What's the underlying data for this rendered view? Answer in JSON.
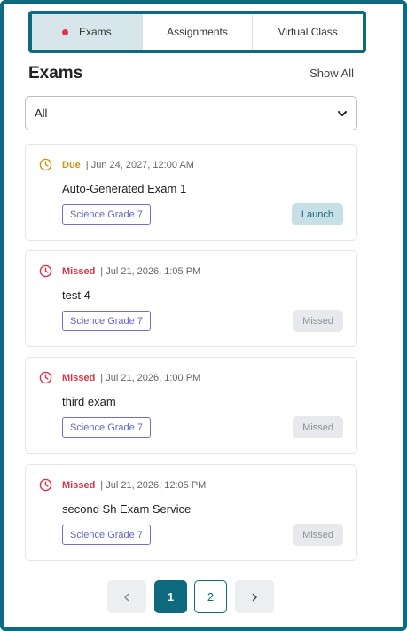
{
  "tabs": [
    {
      "label": "Exams",
      "active": true
    },
    {
      "label": "Assignments",
      "active": false
    },
    {
      "label": "Virtual Class",
      "active": false
    }
  ],
  "header": {
    "title": "Exams",
    "show_all": "Show All"
  },
  "filter": {
    "selected": "All"
  },
  "exams": [
    {
      "status": "Due",
      "date": "| Jun 24, 2027, 12:00 AM",
      "title": "Auto-Generated Exam 1",
      "tag": "Science Grade 7",
      "action": "Launch"
    },
    {
      "status": "Missed",
      "date": "| Jul 21, 2026, 1:05 PM",
      "title": "test 4",
      "tag": "Science Grade 7",
      "action": "Missed"
    },
    {
      "status": "Missed",
      "date": "| Jul 21, 2026, 1:00 PM",
      "title": "third exam",
      "tag": "Science Grade 7",
      "action": "Missed"
    },
    {
      "status": "Missed",
      "date": "| Jul 21, 2026, 12:05 PM",
      "title": "second Sh Exam Service",
      "tag": "Science Grade 7",
      "action": "Missed"
    }
  ],
  "pagination": {
    "prev": "‹",
    "pages": [
      "1",
      "2"
    ],
    "current": "1",
    "next": "›"
  },
  "colors": {
    "primary": "#0e6b7f",
    "due": "#c99414",
    "missed": "#d9334a",
    "tag": "#6466c8",
    "active_dot": "#e0344b"
  },
  "icons": {
    "status_icon": "clock-icon",
    "filter_icon": "chevron-down-icon"
  }
}
